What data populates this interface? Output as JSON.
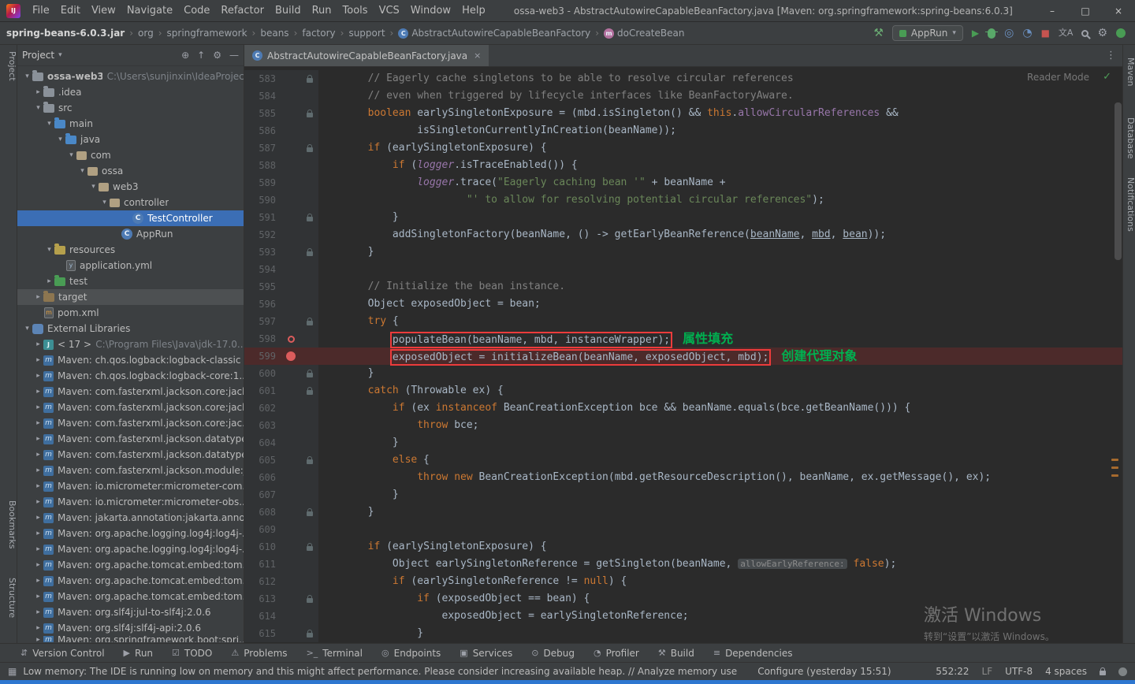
{
  "window": {
    "logo": "IJ",
    "menus": [
      "File",
      "Edit",
      "View",
      "Navigate",
      "Code",
      "Refactor",
      "Build",
      "Run",
      "Tools",
      "VCS",
      "Window",
      "Help"
    ],
    "title": "ossa-web3 - AbstractAutowireCapableBeanFactory.java [Maven: org.springframework:spring-beans:6.0.3]",
    "controls": {
      "minimize": "–",
      "maximize": "□",
      "close": "×"
    }
  },
  "icons": {
    "build": "⚒",
    "run": "▶",
    "coverage": "◎",
    "profiler": "◔",
    "stop": "■",
    "translate": "文A",
    "settings": "⚙",
    "chevron_down": "▾",
    "more": "⋮",
    "locate": "⊕",
    "collapse_all": "↑",
    "hide": "—",
    "grid": "▦",
    "check": "✓",
    "class_badge": "C",
    "method_badge": "m",
    "yml_badge": "y",
    "jdk_badge": "J",
    "maven_badge": "m"
  },
  "navbar": {
    "separator": "›",
    "run_config": "AppRun",
    "breadcrumbs": [
      {
        "label": "spring-beans-6.0.3.jar",
        "bold": true
      },
      {
        "label": "org"
      },
      {
        "label": "springframework"
      },
      {
        "label": "beans"
      },
      {
        "label": "factory"
      },
      {
        "label": "support"
      },
      {
        "label": "AbstractAutowireCapableBeanFactory",
        "icon": "class"
      },
      {
        "label": "doCreateBean",
        "icon": "method"
      }
    ]
  },
  "left_strip": {
    "items": [
      {
        "label": "Project",
        "active": true
      },
      {
        "label": "Bookmarks"
      },
      {
        "label": "Structure"
      }
    ]
  },
  "right_strip": {
    "items": [
      {
        "label": "Maven"
      },
      {
        "label": "Database"
      },
      {
        "label": "Notifications"
      }
    ]
  },
  "project_panel": {
    "title": "Project",
    "header_icons": [
      {
        "name": "locate-file-icon",
        "glyph": "⊕"
      },
      {
        "name": "collapse-all-icon",
        "glyph": "↑"
      },
      {
        "name": "settings-icon",
        "glyph": "⚙"
      },
      {
        "name": "hide-panel-icon",
        "glyph": "—"
      }
    ],
    "tree": [
      {
        "label": "ossa-web3",
        "meta": "C:\\Users\\sunjinxin\\IdeaProject",
        "depth": 0,
        "chev": "open",
        "icon": "folder",
        "bold": true
      },
      {
        "label": ".idea",
        "depth": 1,
        "chev": "closed",
        "icon": "folder"
      },
      {
        "label": "src",
        "depth": 1,
        "chev": "open",
        "icon": "folder"
      },
      {
        "label": "main",
        "depth": 2,
        "chev": "open",
        "icon": "srcroot"
      },
      {
        "label": "java",
        "depth": 3,
        "chev": "open",
        "icon": "srcroot"
      },
      {
        "label": "com",
        "depth": 4,
        "chev": "open",
        "icon": "package"
      },
      {
        "label": "ossa",
        "depth": 5,
        "chev": "open",
        "icon": "package"
      },
      {
        "label": "web3",
        "depth": 6,
        "chev": "open",
        "icon": "package"
      },
      {
        "label": "controller",
        "depth": 7,
        "chev": "open",
        "icon": "package"
      },
      {
        "label": "TestController",
        "depth": 10,
        "icon": "class",
        "selected": true
      },
      {
        "label": "AppRun",
        "depth": 9,
        "icon": "class"
      },
      {
        "label": "resources",
        "depth": 2,
        "chev": "open",
        "icon": "resroot"
      },
      {
        "label": "application.yml",
        "depth": 4,
        "icon": "yml"
      },
      {
        "label": "test",
        "depth": 2,
        "chev": "closed",
        "icon": "testroot"
      },
      {
        "label": "target",
        "depth": 1,
        "chev": "closed",
        "icon": "excluded",
        "secondary": true
      },
      {
        "label": "pom.xml",
        "depth": 2,
        "icon": "pom"
      },
      {
        "label": "External Libraries",
        "depth": 0,
        "chev": "open",
        "icon": "libroot"
      },
      {
        "label": "< 17 >",
        "meta": "C:\\Program Files\\Java\\jdk-17.0...",
        "depth": 1,
        "chev": "closed",
        "icon": "jdk"
      },
      {
        "label": "Maven: ch.qos.logback:logback-classic",
        "depth": 1,
        "chev": "closed",
        "icon": "mavenlib"
      },
      {
        "label": "Maven: ch.qos.logback:logback-core:1...",
        "depth": 1,
        "chev": "closed",
        "icon": "mavenlib"
      },
      {
        "label": "Maven: com.fasterxml.jackson.core:jack...",
        "depth": 1,
        "chev": "closed",
        "icon": "mavenlib"
      },
      {
        "label": "Maven: com.fasterxml.jackson.core:jack...",
        "depth": 1,
        "chev": "closed",
        "icon": "mavenlib"
      },
      {
        "label": "Maven: com.fasterxml.jackson.core:jac...",
        "depth": 1,
        "chev": "closed",
        "icon": "mavenlib"
      },
      {
        "label": "Maven: com.fasterxml.jackson.datatype...",
        "depth": 1,
        "chev": "closed",
        "icon": "mavenlib"
      },
      {
        "label": "Maven: com.fasterxml.jackson.datatype...",
        "depth": 1,
        "chev": "closed",
        "icon": "mavenlib"
      },
      {
        "label": "Maven: com.fasterxml.jackson.module:j...",
        "depth": 1,
        "chev": "closed",
        "icon": "mavenlib"
      },
      {
        "label": "Maven: io.micrometer:micrometer-com...",
        "depth": 1,
        "chev": "closed",
        "icon": "mavenlib"
      },
      {
        "label": "Maven: io.micrometer:micrometer-obs...",
        "depth": 1,
        "chev": "closed",
        "icon": "mavenlib"
      },
      {
        "label": "Maven: jakarta.annotation:jakarta.anno...",
        "depth": 1,
        "chev": "closed",
        "icon": "mavenlib"
      },
      {
        "label": "Maven: org.apache.logging.log4j:log4j-...",
        "depth": 1,
        "chev": "closed",
        "icon": "mavenlib"
      },
      {
        "label": "Maven: org.apache.logging.log4j:log4j-...",
        "depth": 1,
        "chev": "closed",
        "icon": "mavenlib"
      },
      {
        "label": "Maven: org.apache.tomcat.embed:tom...",
        "depth": 1,
        "chev": "closed",
        "icon": "mavenlib"
      },
      {
        "label": "Maven: org.apache.tomcat.embed:tom...",
        "depth": 1,
        "chev": "closed",
        "icon": "mavenlib"
      },
      {
        "label": "Maven: org.apache.tomcat.embed:tom...",
        "depth": 1,
        "chev": "closed",
        "icon": "mavenlib"
      },
      {
        "label": "Maven: org.slf4j:jul-to-slf4j:2.0.6",
        "depth": 1,
        "chev": "closed",
        "icon": "mavenlib"
      },
      {
        "label": "Maven: org.slf4j:slf4j-api:2.0.6",
        "depth": 1,
        "chev": "closed",
        "icon": "mavenlib"
      },
      {
        "label": "Maven: org.springframework.boot:spri...",
        "depth": 1,
        "chev": "closed",
        "icon": "mavenlib",
        "clipped": true
      }
    ]
  },
  "editor": {
    "tab": {
      "label": "AbstractAutowireCapableBeanFactory.java",
      "close": "×"
    },
    "reader_mode": "Reader Mode",
    "lines": [
      {
        "no": 583,
        "lock": true,
        "seg": [
          [
            "c",
            "        // Eagerly cache singletons to be able to resolve circular references"
          ]
        ]
      },
      {
        "no": 584,
        "seg": [
          [
            "c",
            "        // even when triggered by lifecycle interfaces like BeanFactoryAware."
          ]
        ]
      },
      {
        "no": 585,
        "lock": true,
        "seg": [
          [
            "p",
            "        "
          ],
          [
            "k",
            "boolean"
          ],
          [
            "p",
            " earlySingletonExposure = (mbd.isSingleton() && "
          ],
          [
            "k",
            "this"
          ],
          [
            "p",
            "."
          ],
          [
            "f",
            "allowCircularReferences"
          ],
          [
            "p",
            " &&"
          ]
        ]
      },
      {
        "no": 586,
        "seg": [
          [
            "p",
            "                isSingletonCurrentlyInCreation(beanName));"
          ]
        ]
      },
      {
        "no": 587,
        "lock": true,
        "seg": [
          [
            "p",
            "        "
          ],
          [
            "k",
            "if"
          ],
          [
            "p",
            " (earlySingletonExposure) {"
          ]
        ]
      },
      {
        "no": 588,
        "seg": [
          [
            "p",
            "            "
          ],
          [
            "k",
            "if"
          ],
          [
            "p",
            " ("
          ],
          [
            "fi",
            "logger"
          ],
          [
            "p",
            ".isTraceEnabled()) {"
          ]
        ]
      },
      {
        "no": 589,
        "seg": [
          [
            "p",
            "                "
          ],
          [
            "fi",
            "logger"
          ],
          [
            "p",
            ".trace("
          ],
          [
            "s",
            "\"Eagerly caching bean '\""
          ],
          [
            "p",
            " + beanName +"
          ]
        ]
      },
      {
        "no": 590,
        "seg": [
          [
            "p",
            "                        "
          ],
          [
            "s",
            "\"' to allow for resolving potential circular references\""
          ],
          [
            "p",
            ");"
          ]
        ]
      },
      {
        "no": 591,
        "lock": true,
        "seg": [
          [
            "p",
            "            }"
          ]
        ]
      },
      {
        "no": 592,
        "seg": [
          [
            "p",
            "            addSingletonFactory(beanName, () -> getEarlyBeanReference("
          ],
          [
            "u",
            "beanName"
          ],
          [
            "p",
            ", "
          ],
          [
            "u",
            "mbd"
          ],
          [
            "p",
            ", "
          ],
          [
            "u",
            "bean"
          ],
          [
            "p",
            "));"
          ]
        ]
      },
      {
        "no": 593,
        "lock": true,
        "seg": [
          [
            "p",
            "        }"
          ]
        ]
      },
      {
        "no": 594,
        "seg": []
      },
      {
        "no": 595,
        "seg": [
          [
            "c",
            "        // Initialize the bean instance."
          ]
        ]
      },
      {
        "no": 596,
        "seg": [
          [
            "p",
            "        Object exposedObject = bean;"
          ]
        ]
      },
      {
        "no": 597,
        "lock": true,
        "seg": [
          [
            "p",
            "        "
          ],
          [
            "k",
            "try"
          ],
          [
            "p",
            " {"
          ]
        ]
      },
      {
        "no": 598,
        "g": "ring",
        "seg": [
          [
            "p",
            "            "
          ]
        ],
        "box": [
          [
            "p",
            "populateBean(beanName, mbd, instanceWrapper);"
          ]
        ],
        "note": "属性填充"
      },
      {
        "no": 599,
        "g": "solid",
        "hl": true,
        "seg": [
          [
            "p",
            "            "
          ]
        ],
        "box": [
          [
            "p",
            "exposedObject = initializeBean(beanName, exposedObject, mbd);"
          ]
        ],
        "note": "创建代理对象"
      },
      {
        "no": 600,
        "lock": true,
        "seg": [
          [
            "p",
            "        }"
          ]
        ]
      },
      {
        "no": 601,
        "lock": true,
        "seg": [
          [
            "p",
            "        "
          ],
          [
            "k",
            "catch"
          ],
          [
            "p",
            " (Throwable ex) {"
          ]
        ]
      },
      {
        "no": 602,
        "seg": [
          [
            "p",
            "            "
          ],
          [
            "k",
            "if"
          ],
          [
            "p",
            " (ex "
          ],
          [
            "k",
            "instanceof"
          ],
          [
            "p",
            " BeanCreationException bce && beanName.equals(bce.getBeanName())) {"
          ]
        ]
      },
      {
        "no": 603,
        "seg": [
          [
            "p",
            "                "
          ],
          [
            "k",
            "throw"
          ],
          [
            "p",
            " bce;"
          ]
        ]
      },
      {
        "no": 604,
        "seg": [
          [
            "p",
            "            }"
          ]
        ]
      },
      {
        "no": 605,
        "lock": true,
        "seg": [
          [
            "p",
            "            "
          ],
          [
            "k",
            "else"
          ],
          [
            "p",
            " {"
          ]
        ]
      },
      {
        "no": 606,
        "seg": [
          [
            "p",
            "                "
          ],
          [
            "k",
            "throw"
          ],
          [
            "p",
            " "
          ],
          [
            "k",
            "new"
          ],
          [
            "p",
            " BeanCreationException(mbd.getResourceDescription(), beanName, ex.getMessage(), ex);"
          ]
        ]
      },
      {
        "no": 607,
        "seg": [
          [
            "p",
            "            }"
          ]
        ]
      },
      {
        "no": 608,
        "lock": true,
        "seg": [
          [
            "p",
            "        }"
          ]
        ]
      },
      {
        "no": 609,
        "seg": []
      },
      {
        "no": 610,
        "lock": true,
        "seg": [
          [
            "p",
            "        "
          ],
          [
            "k",
            "if"
          ],
          [
            "p",
            " (earlySingletonExposure) {"
          ]
        ]
      },
      {
        "no": 611,
        "seg": [
          [
            "p",
            "            Object earlySingletonReference = getSingleton(beanName, "
          ],
          [
            "hint",
            "allowEarlyReference:"
          ],
          [
            "p",
            " "
          ],
          [
            "k",
            "false"
          ],
          [
            "p",
            ");"
          ]
        ]
      },
      {
        "no": 612,
        "seg": [
          [
            "p",
            "            "
          ],
          [
            "k",
            "if"
          ],
          [
            "p",
            " (earlySingletonReference != "
          ],
          [
            "k",
            "null"
          ],
          [
            "p",
            ") {"
          ]
        ]
      },
      {
        "no": 613,
        "lock": true,
        "seg": [
          [
            "p",
            "                "
          ],
          [
            "k",
            "if"
          ],
          [
            "p",
            " (exposedObject == bean) {"
          ]
        ]
      },
      {
        "no": 614,
        "seg": [
          [
            "p",
            "                    exposedObject = earlySingletonReference;"
          ]
        ]
      },
      {
        "no": 615,
        "lock": true,
        "seg": [
          [
            "p",
            "                }"
          ]
        ]
      }
    ]
  },
  "bottom_bar": {
    "items": [
      {
        "label": "Version Control",
        "glyph": "⇵"
      },
      {
        "label": "Run",
        "glyph": "▶"
      },
      {
        "label": "TODO",
        "glyph": "☑"
      },
      {
        "label": "Problems",
        "glyph": "⚠"
      },
      {
        "label": "Terminal",
        "glyph": ">_"
      },
      {
        "label": "Endpoints",
        "glyph": "◎"
      },
      {
        "label": "Services",
        "glyph": "▣"
      },
      {
        "label": "Debug",
        "glyph": "⊙"
      },
      {
        "label": "Profiler",
        "glyph": "◔"
      },
      {
        "label": "Build",
        "glyph": "⚒"
      },
      {
        "label": "Dependencies",
        "glyph": "≡"
      }
    ]
  },
  "status_bar": {
    "message": "Low memory: The IDE is running low on memory and this might affect performance. Please consider increasing available heap. // Analyze memory use",
    "configure": "Configure (yesterday 15:51)",
    "caret": "552:22",
    "line_separator": "LF",
    "encoding": "UTF-8",
    "indent": "4 spaces"
  },
  "watermark": {
    "line1": "激活 Windows",
    "line2": "转到“设置”以激活 Windows。"
  },
  "colors": {
    "accent_selection": "#3b6eb5",
    "keyword": "#cc7832",
    "string": "#6a8759",
    "comment": "#808080",
    "field": "#9876aa",
    "annotation_box": "#ec3b3b",
    "annotation_note": "#00b050",
    "breakpoint_line_bg": "#4c2a2a",
    "taskbar_accent": "#2e77d0"
  }
}
